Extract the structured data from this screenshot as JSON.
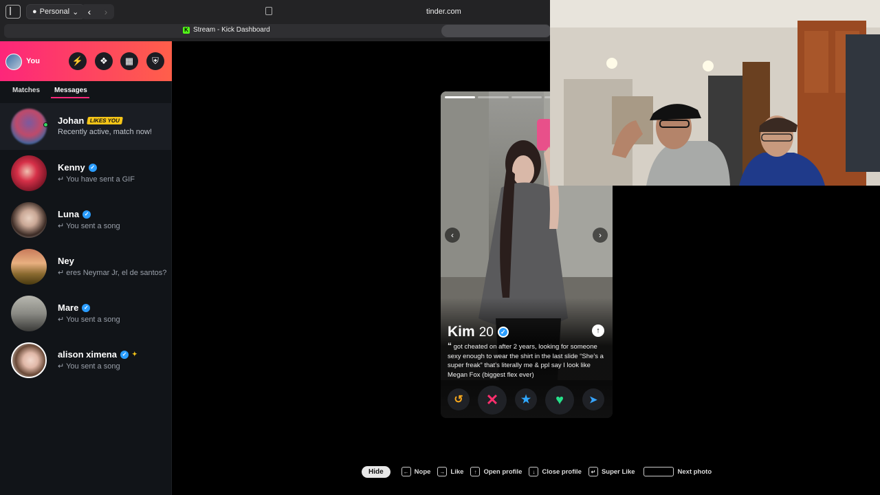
{
  "browser": {
    "profile_label": "Personal",
    "url": "tinder.com",
    "tab_title": "Stream - Kick Dashboard"
  },
  "sidebar": {
    "self_name": "You",
    "tabs": [
      "Matches",
      "Messages"
    ],
    "messages": [
      {
        "name": "Johan",
        "badge": "LIKES YOU",
        "text": "Recently active, match now!",
        "verified": false
      },
      {
        "name": "Kenny",
        "text": "You have sent a GIF",
        "verified": true
      },
      {
        "name": "Luna",
        "text": "You sent a song",
        "verified": true
      },
      {
        "name": "Ney",
        "text": "eres Neymar Jr, el de santos?",
        "verified": false
      },
      {
        "name": "Mare",
        "text": "You sent a song",
        "verified": true
      },
      {
        "name": "alison ximena",
        "text": "You sent a song",
        "verified": true
      }
    ]
  },
  "card": {
    "name": "Kim",
    "age": "20",
    "bio": "got cheated on after 2 years, looking for someone sexy enough to wear the shirt in the last slide “She’s a super freak” that’s literally me & ppl say I look like Megan Fox (biggest flex ever)"
  },
  "shortcuts": {
    "hide": "Hide",
    "nope": "Nope",
    "like": "Like",
    "open_profile": "Open profile",
    "close_profile": "Close profile",
    "super_like": "Super Like",
    "next_photo": "Next photo"
  },
  "colors": {
    "brand_gradient_start": "#fd267a",
    "brand_gradient_end": "#ff5f4a",
    "verified_blue": "#2a9dff",
    "likes_badge": "#f5c518"
  }
}
